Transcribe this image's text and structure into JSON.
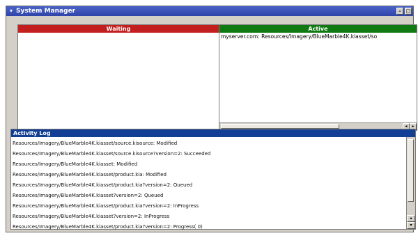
{
  "window": {
    "title": "System Manager",
    "menu_glyph": "▾",
    "minimize_glyph": "–",
    "maximize_glyph": "□"
  },
  "waiting": {
    "label": "Waiting",
    "color": "#c41f1f"
  },
  "active": {
    "label": "Active",
    "color": "#0f7a12",
    "items": [
      "myserver.com:  Resources/Imagery/BlueMarble4K.kiasset/so"
    ]
  },
  "log": {
    "title": "Activity Log",
    "lines": [
      "Resources/Imagery/BlueMarble4K.kiasset/source.kisource: Modified",
      "Resources/Imagery/BlueMarble4K.kiasset/source.kisource?version=2: Succeeded",
      "Resources/Imagery/BlueMarble4K.kiasset: Modified",
      "Resources/Imagery/BlueMarble4K.kiasset/product.kia: Modified",
      "Resources/Imagery/BlueMarble4K.kiasset/product.kia?version=2: Queued",
      "Resources/Imagery/BlueMarble4K.kiasset?version=2: Queued",
      "Resources/Imagery/BlueMarble4K.kiasset/product.kia?version=2: InProgress",
      "Resources/Imagery/BlueMarble4K.kiasset?version=2: InProgress",
      "Resources/Imagery/BlueMarble4K.kiasset/product.kia?version=2: Progress( 0)"
    ]
  },
  "scroll": {
    "left": "◂",
    "right": "▸",
    "up": "▴",
    "down": "▾"
  }
}
